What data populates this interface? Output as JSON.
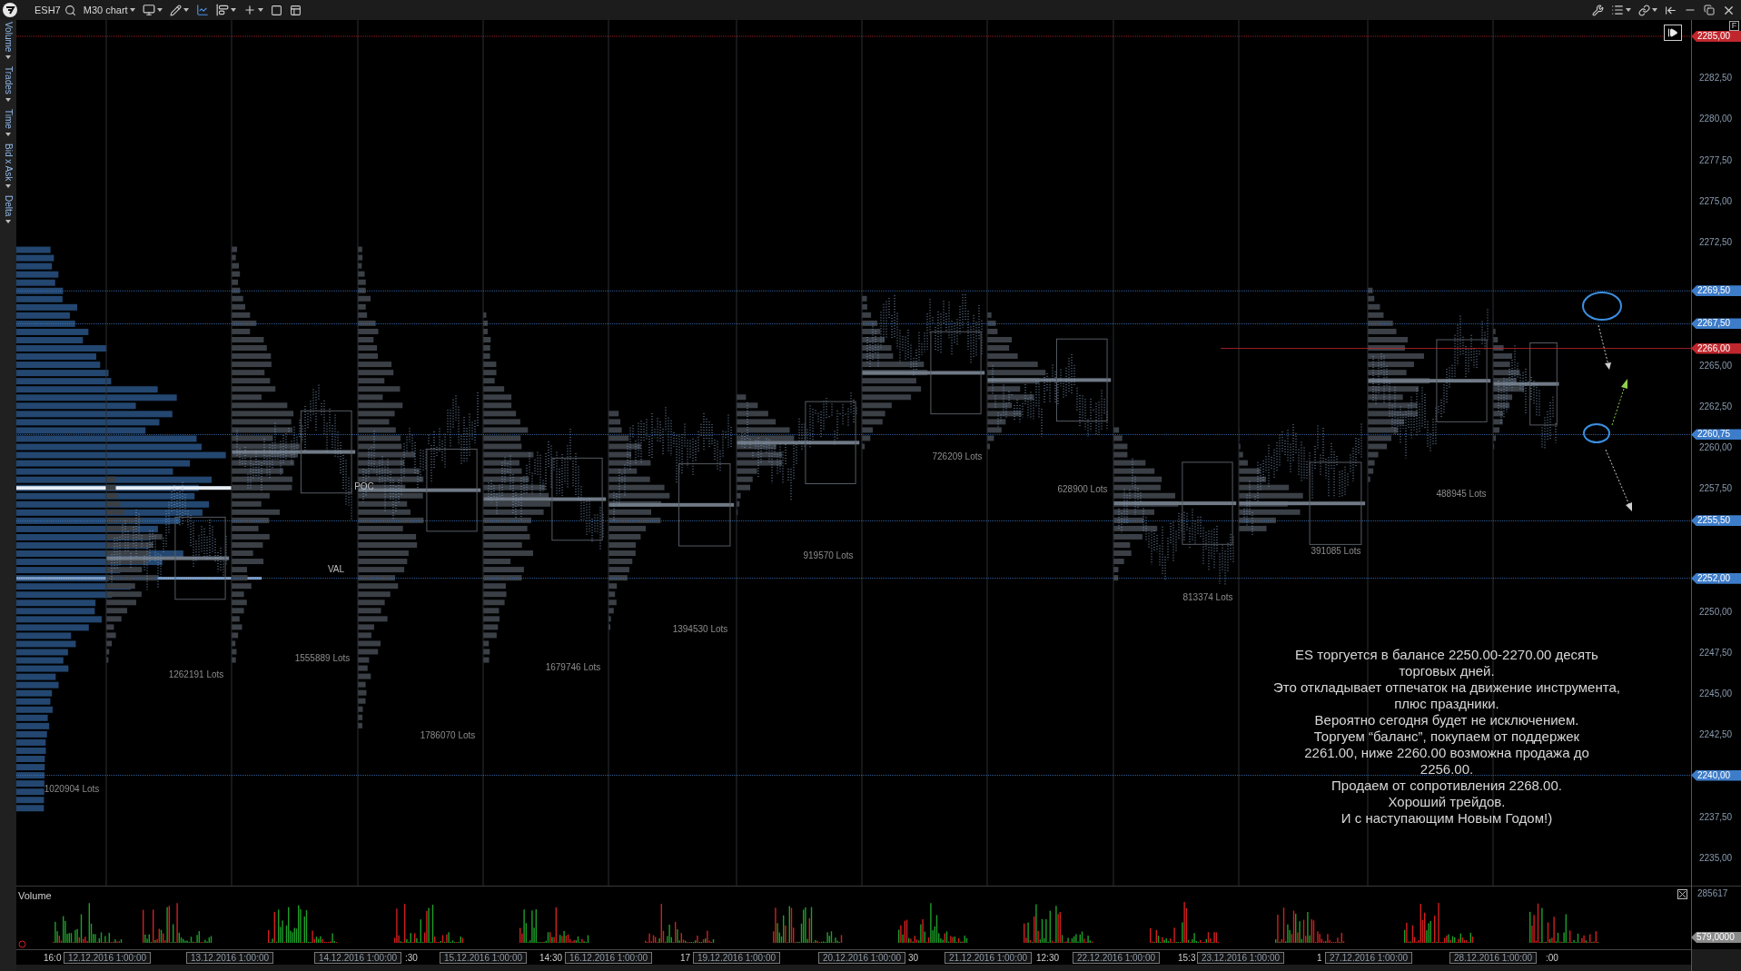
{
  "toolbar": {
    "symbol": "ESH7",
    "timeframe": "M30 chart"
  },
  "indicator_tabs": [
    {
      "label": "Volume"
    },
    {
      "label": "Trades"
    },
    {
      "label": "Time"
    },
    {
      "label": "Bid x Ask"
    },
    {
      "label": "Delta"
    }
  ],
  "price_axis": {
    "scale_button": "F",
    "ticks": [
      "2282,50",
      "2280,00",
      "2277,50",
      "2275,00",
      "2272,50",
      "2265,00",
      "2262,50",
      "2260,00",
      "2257,50",
      "2250,00",
      "2247,50",
      "2245,00",
      "2242,50",
      "2237,50",
      "2235,00"
    ],
    "levels": [
      {
        "label": "2285,00",
        "color": "#c0272d"
      },
      {
        "label": "2269,50",
        "color": "#3d7cc9"
      },
      {
        "label": "2267,50",
        "color": "#3d7cc9"
      },
      {
        "label": "2266,00",
        "color": "#c0272d"
      },
      {
        "label": "2260,75",
        "color": "#3d7cc9"
      },
      {
        "label": "2255,50",
        "color": "#3d7cc9"
      },
      {
        "label": "2252,00",
        "color": "#3d7cc9"
      },
      {
        "label": "2240,00",
        "color": "#3d7cc9"
      }
    ]
  },
  "profile_labels": [
    "1020904 Lots",
    "1262191 Lots",
    "1555889 Lots",
    "1786070 Lots",
    "1679746 Lots",
    "1394530 Lots",
    "919570 Lots",
    "726209 Lots",
    "628900 Lots",
    "813374 Lots",
    "391085 Lots",
    "488945 Lots"
  ],
  "markers": [
    "POC",
    "VAL"
  ],
  "note": {
    "lines": [
      "ES торгуется в балансе 2250.00-2270.00  десять",
      "торговых дней.",
      "Это откладывает отпечаток на движение инструмента,",
      "плюс праздники.",
      "Вероятно сегодня будет не исключением.",
      "Торгуем “баланс”, покупаем от поддержек",
      "2261.00, ниже 2260.00 возможна продажа до",
      "2256.00.",
      "Продаем от сопротивления 2268.00.",
      "Хороший трейдов.",
      "И с наступающим Новым Годом!)"
    ]
  },
  "volume_pane": {
    "title": "Volume",
    "max": "285617",
    "current": "579,0000"
  },
  "time_axis": [
    {
      "text": "16:0",
      "kind": "fragment"
    },
    {
      "text": "12.12.2016 1:00:00",
      "kind": "date"
    },
    {
      "text": "13.12.2016 1:00:00",
      "kind": "date"
    },
    {
      "text": "14.12.2016 1:00:00",
      "kind": "date"
    },
    {
      "text": ":30",
      "kind": "fragment"
    },
    {
      "text": "15.12.2016 1:00:00",
      "kind": "date"
    },
    {
      "text": "14:30",
      "kind": "fragment"
    },
    {
      "text": "16.12.2016 1:00:00",
      "kind": "date"
    },
    {
      "text": "17",
      "kind": "fragment"
    },
    {
      "text": "19.12.2016 1:00:00",
      "kind": "date"
    },
    {
      "text": "20.12.2016 1:00:00",
      "kind": "date"
    },
    {
      "text": "30",
      "kind": "fragment"
    },
    {
      "text": "21.12.2016 1:00:00",
      "kind": "date"
    },
    {
      "text": "12:30",
      "kind": "fragment"
    },
    {
      "text": "22.12.2016 1:00:00",
      "kind": "date"
    },
    {
      "text": "15:3",
      "kind": "fragment"
    },
    {
      "text": "23.12.2016 1:00:00",
      "kind": "date"
    },
    {
      "text": "1",
      "kind": "fragment"
    },
    {
      "text": "27.12.2016 1:00:00",
      "kind": "date"
    },
    {
      "text": "28.12.2016 1:00:00",
      "kind": "date"
    },
    {
      "text": ":00",
      "kind": "fragment"
    }
  ]
}
